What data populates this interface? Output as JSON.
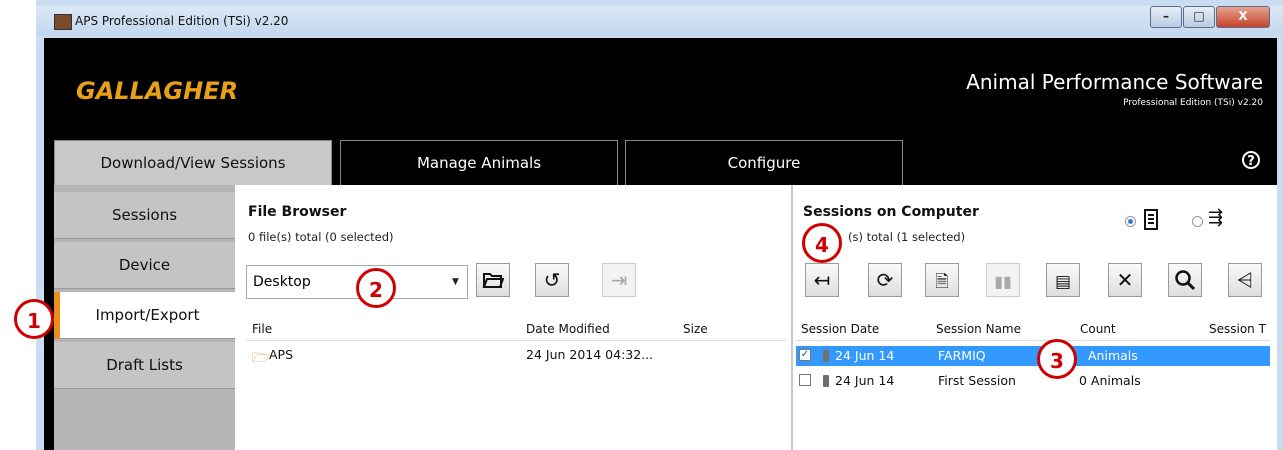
{
  "window": {
    "title": "APS Professional Edition (TSi) v2.20",
    "controls": [
      "–",
      "□",
      "X"
    ]
  },
  "header": {
    "brand": "GALLAGHER",
    "app_title": "Animal Performance Software",
    "app_subtitle": "Professional Edition (TSi) v2.20",
    "help_label": "?"
  },
  "tabs": [
    {
      "label": "Download/View Sessions",
      "active": true
    },
    {
      "label": "Manage Animals",
      "active": false
    },
    {
      "label": "Configure",
      "active": false
    }
  ],
  "sidebar": {
    "items": [
      {
        "label": "Sessions",
        "selected": false
      },
      {
        "label": "Device",
        "selected": false
      },
      {
        "label": "Import/Export",
        "selected": true
      },
      {
        "label": "Draft Lists",
        "selected": false
      }
    ]
  },
  "file_browser": {
    "title": "File Browser",
    "summary": "0 file(s) total (0 selected)",
    "location": "Desktop",
    "columns": [
      "File",
      "Date Modified",
      "Size"
    ],
    "rows": [
      {
        "file": "APS",
        "date_modified": "24 Jun 2014 04:32...",
        "size": ""
      }
    ]
  },
  "sessions": {
    "title": "Sessions on Computer",
    "summary": "(s) total (1 selected)",
    "columns": [
      "Session Date",
      "Session Name",
      "Count",
      "Session T"
    ],
    "rows": [
      {
        "checked": true,
        "date": "24 Jun 14",
        "name": "FARMIQ",
        "count": "Animals",
        "selected": true
      },
      {
        "checked": false,
        "date": "24 Jun 14",
        "name": "First Session",
        "count": "0 Animals",
        "selected": false
      }
    ]
  },
  "markers": [
    "1",
    "2",
    "3",
    "4"
  ],
  "colors": {
    "accent_orange": "#e8901a",
    "brand_gold": "#e8a017",
    "selection_blue": "#3399ff",
    "marker_red": "#d10000"
  },
  "icons": {
    "file_browser_toolbar": [
      "open-folder-icon",
      "refresh-icon",
      "export-arrow-icon"
    ],
    "sessions_toolbar": [
      "import-arrow-icon",
      "sync-icon",
      "view-session-icon",
      "chart-icon",
      "report-icon",
      "delete-icon",
      "search-icon",
      "share-icon"
    ]
  }
}
